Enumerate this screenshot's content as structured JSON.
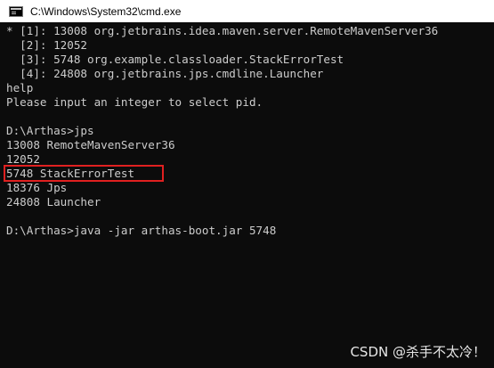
{
  "window": {
    "title": "C:\\Windows\\System32\\cmd.exe",
    "icon": "cmd-console-icon"
  },
  "console": {
    "lines": [
      "* [1]: 13008 org.jetbrains.idea.maven.server.RemoteMavenServer36",
      "  [2]: 12052",
      "  [3]: 5748 org.example.classloader.StackErrorTest",
      "  [4]: 24808 org.jetbrains.jps.cmdline.Launcher",
      "help",
      "Please input an integer to select pid.",
      "",
      "D:\\Arthas>jps",
      "13008 RemoteMavenServer36",
      "12052",
      "5748 StackErrorTest",
      "18376 Jps",
      "24808 Launcher",
      "",
      "D:\\Arthas>java -jar arthas-boot.jar 5748"
    ],
    "text_color": "#cccccc",
    "background_color": "#0c0c0c",
    "highlight_color": "#e02020"
  },
  "watermark": "CSDN @杀手不太冷！"
}
